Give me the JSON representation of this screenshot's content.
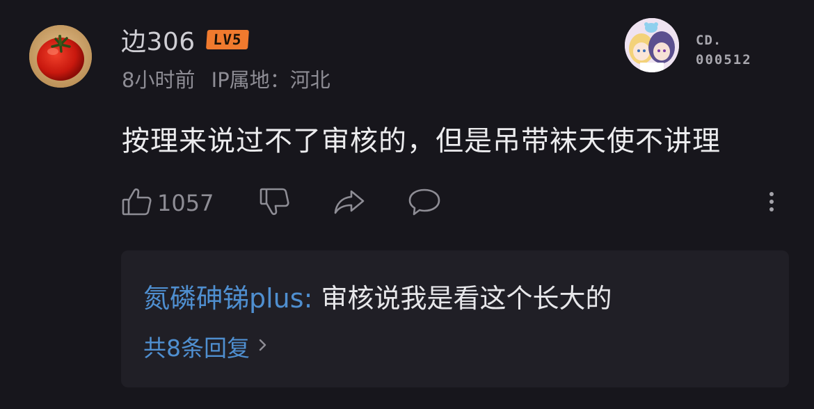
{
  "comment": {
    "username": "边306",
    "level": "LV5",
    "time": "8小时前",
    "ip_location": "IP属地：河北",
    "text": "按理来说过不了审核的，但是吊带袜天使不讲理",
    "like_count": "1057"
  },
  "decoration": {
    "id_line1": "CD.",
    "id_line2": "000512"
  },
  "reply_preview": {
    "author": "氮磷砷锑plus",
    "separator": ":",
    "text": "审核说我是看这个长大的",
    "more_label": "共8条回复"
  },
  "icons": {
    "avatar": "tomato-avatar",
    "like": "thumbs-up-icon",
    "dislike": "thumbs-down-icon",
    "share": "share-icon",
    "reply": "comment-icon",
    "more": "more-vertical-icon",
    "expand": "chevron-right-icon"
  },
  "colors": {
    "background": "#17161c",
    "reply_box": "#201f26",
    "level_badge": "#f07a2e",
    "link_blue": "#4f8fd0",
    "muted_text": "#8e8d95"
  }
}
